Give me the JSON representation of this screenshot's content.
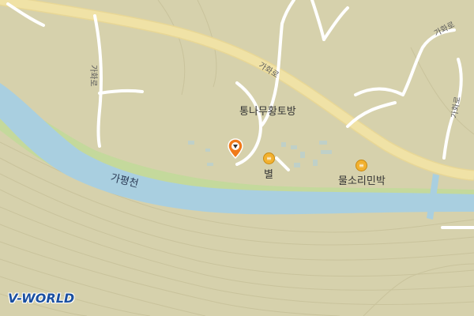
{
  "map": {
    "provider_logo": "V-WORLD",
    "colors": {
      "land": "#d6d1ac",
      "road": "#f0e2a6",
      "minor_road": "#ffffff",
      "river": "#a9cfe0",
      "riverbank": "#c4d99c",
      "accent_pin": "#f07a1a",
      "poi": "#f2b12f"
    },
    "road_labels": [
      {
        "id": "gahwa-1",
        "text": "가화로"
      },
      {
        "id": "gahwa-2",
        "text": "가화로"
      },
      {
        "id": "gahwa-3",
        "text": "가화로"
      },
      {
        "id": "gahwa-4",
        "text": "가화로"
      }
    ],
    "river_label": "가평천",
    "places": [
      {
        "id": "tongnamu",
        "text": "통나무황토방",
        "has_poi_icon": false
      },
      {
        "id": "byeol",
        "text": "별",
        "has_poi_icon": true,
        "icon": "lodging-icon"
      },
      {
        "id": "mulsori",
        "text": "물소리민박",
        "has_poi_icon": true,
        "icon": "lodging-icon"
      }
    ],
    "selected_marker": {
      "icon": "location-pin-icon"
    }
  }
}
